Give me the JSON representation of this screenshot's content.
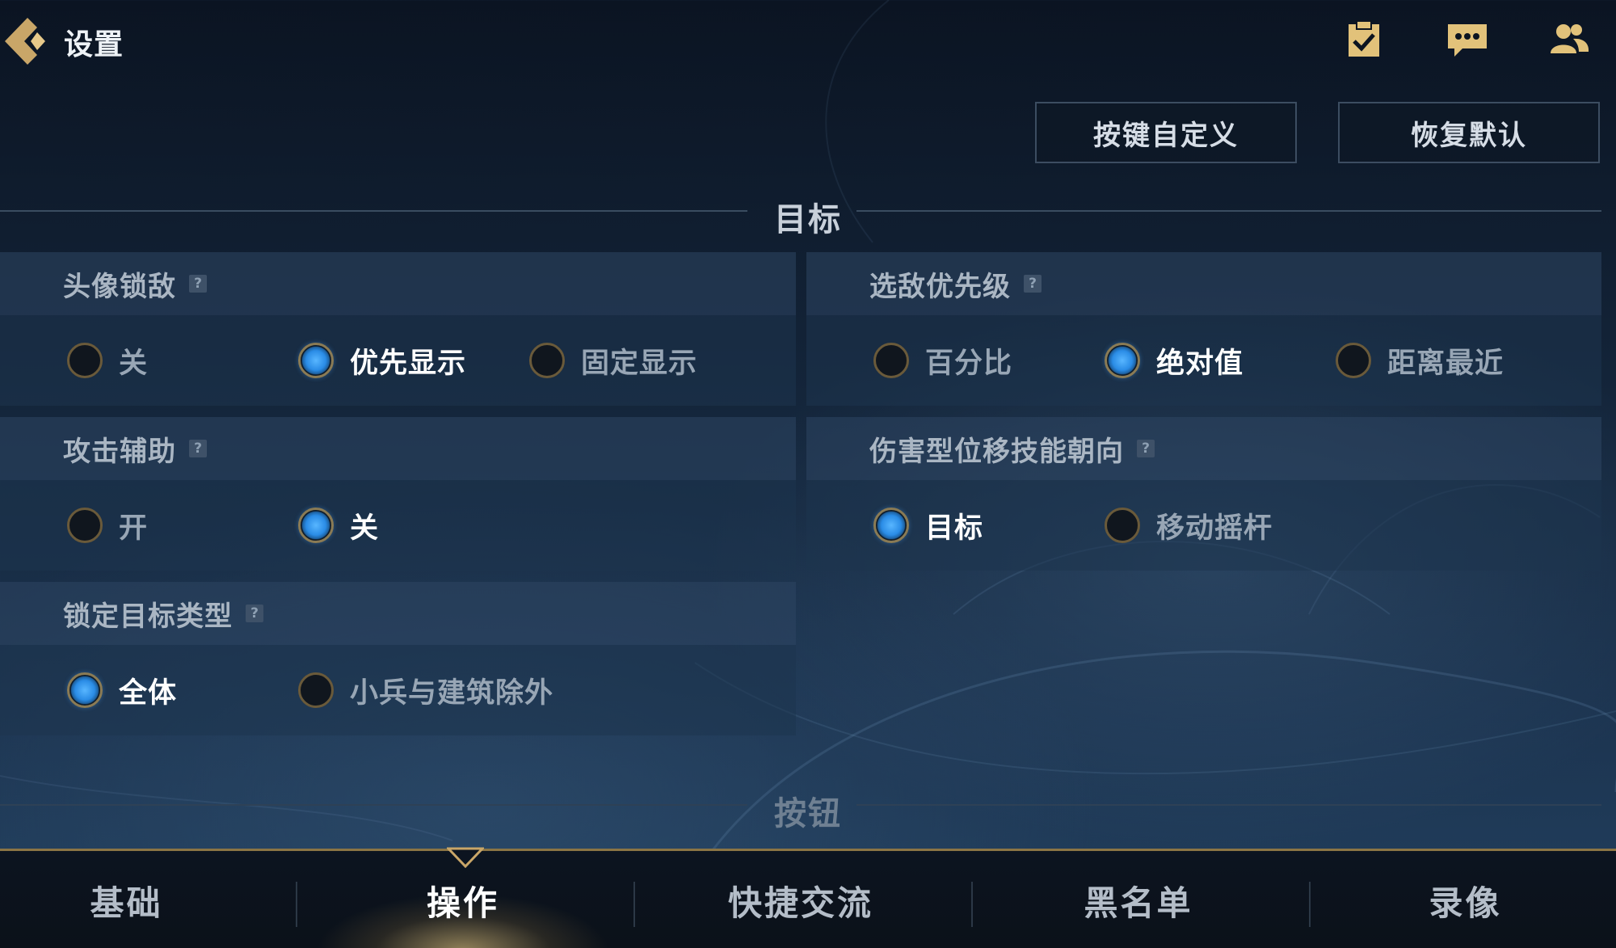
{
  "header": {
    "title": "设置",
    "icons": [
      "checklist-icon",
      "chat-icon",
      "friends-icon"
    ]
  },
  "actions": {
    "customize_label": "按键自定义",
    "restore_label": "恢复默认"
  },
  "sections": {
    "target": "目标",
    "buttons": "按钮"
  },
  "settings": [
    {
      "label": "头像锁敌",
      "options": [
        "关",
        "优先显示",
        "固定显示"
      ],
      "selected": "优先显示"
    },
    {
      "label": "选敌优先级",
      "options": [
        "百分比",
        "绝对值",
        "距离最近"
      ],
      "selected": "绝对值"
    },
    {
      "label": "攻击辅助",
      "options": [
        "开",
        "关"
      ],
      "selected": "关"
    },
    {
      "label": "伤害型位移技能朝向",
      "options": [
        "目标",
        "移动摇杆"
      ],
      "selected": "目标"
    },
    {
      "label": "锁定目标类型",
      "options": [
        "全体",
        "小兵与建筑除外"
      ],
      "selected": "全体"
    }
  ],
  "help_glyph": "?",
  "nav": {
    "tabs": [
      "基础",
      "操作",
      "快捷交流",
      "黑名单",
      "录像"
    ],
    "active": "操作"
  },
  "colors": {
    "accent_gold": "#8b7545",
    "radio_selected": "#2a8ce6",
    "background": "#122236"
  }
}
